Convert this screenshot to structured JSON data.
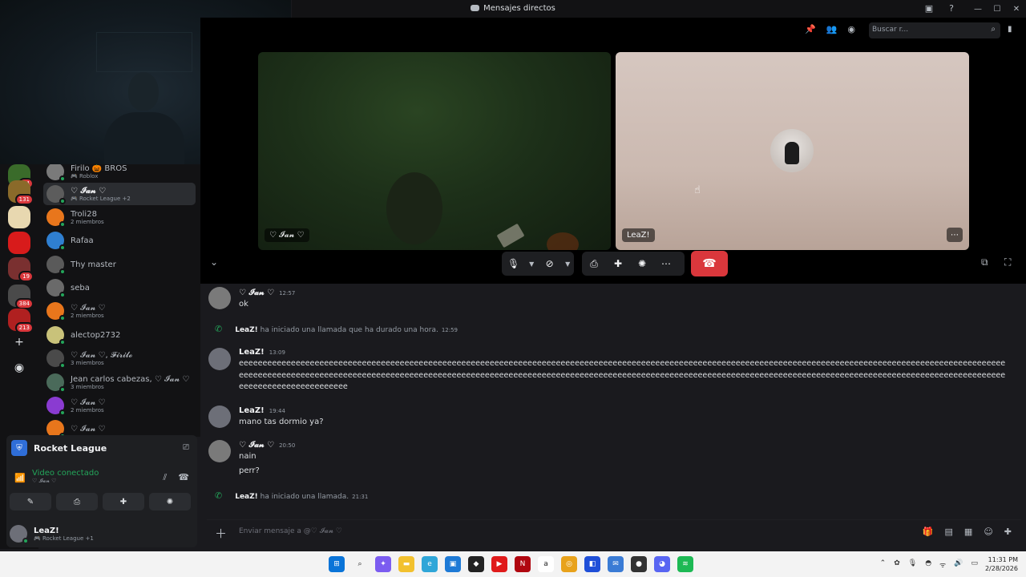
{
  "window": {
    "title": "Mensajes directos"
  },
  "search": {
    "placeholder": "Buscar r..."
  },
  "servers": [
    {
      "color": "#3a6b2a",
      "badge": "14"
    },
    {
      "color": "#8a6a2a",
      "badge": "131"
    },
    {
      "color": "#e8d8b0",
      "badge": ""
    },
    {
      "color": "#d81b1b",
      "badge": ""
    },
    {
      "color": "#7a3030",
      "badge": "19"
    },
    {
      "color": "#4a4a4a",
      "badge": "384"
    },
    {
      "color": "#b02020",
      "badge": "213"
    }
  ],
  "dms": [
    {
      "name": "Firilo 🎃 BROS",
      "sub": "🎮 Roblox",
      "color": "#7a7a7a",
      "active": false
    },
    {
      "name": "♡ 𝓘𝓪𝓷 ♡",
      "sub": "🎮 Rocket League +2",
      "color": "#5c5c5c",
      "active": true
    },
    {
      "name": "Troli28",
      "sub": "2 miembros",
      "color": "#e8761c",
      "active": false
    },
    {
      "name": "Rafaa",
      "sub": "",
      "color": "#2f7fd1",
      "active": false
    },
    {
      "name": "Thy master",
      "sub": "",
      "color": "#5a5a5a",
      "active": false
    },
    {
      "name": "seba",
      "sub": "",
      "color": "#6a6a6a",
      "active": false
    },
    {
      "name": "♡ 𝓘𝓪𝓷 ♡",
      "sub": "2 miembros",
      "color": "#e8761c",
      "active": false
    },
    {
      "name": "alectop2732",
      "sub": "",
      "color": "#c9c27a",
      "active": false
    },
    {
      "name": "♡ 𝓘𝓪𝓷 ♡, 𝓕𝓲𝓻𝓲𝓵𝓸",
      "sub": "3 miembros",
      "color": "#4a4a4a",
      "active": false
    },
    {
      "name": "Jean carlos cabezas, ♡ 𝓘𝓪𝓷 ♡",
      "sub": "3 miembros",
      "color": "#4a6a5a",
      "active": false
    },
    {
      "name": "♡ 𝓘𝓪𝓷 ♡",
      "sub": "2 miembros",
      "color": "#8a3bd1",
      "active": false
    },
    {
      "name": "♡ 𝓘𝓪𝓷 ♡",
      "sub": "",
      "color": "#e8761c",
      "active": false
    }
  ],
  "voice": {
    "game": "Rocket League",
    "status": "Video conectado",
    "channel": "♡ 𝓘𝓪𝓷 ♡"
  },
  "user": {
    "name": "LeaZ!",
    "status": "🎮 Rocket League +1"
  },
  "call": {
    "tile1_name": "♡ 𝓘𝓪𝓷 ♡",
    "tile2_name": "LeaZ!"
  },
  "messages": {
    "m1": {
      "author": "♡ 𝓘𝓪𝓷 ♡",
      "time": "12:57",
      "text": "ok"
    },
    "s1": {
      "who": "LeaZ!",
      "text": "ha iniciado una llamada que ha durado una hora.",
      "time": "12:59"
    },
    "m2": {
      "author": "LeaZ!",
      "time": "13:09",
      "text": "eeeeeeeeeeeeeeeeeeeeeeeeeeeeeeeeeeeeeeeeeeeeeeeeeeeeeeeeeeeeeeeeeeeeeeeeeeeeeeeeeeeeeeeeeeeeeeeeeeeeeeeeeeeeeeeeeeeeeeeeeeeeeeeeeeeeeeeeeeeeeeeeeeeeeeeeeeeeeeeeeeeeeeeeeeeeeeeeeeeeeeeeeeeeeeeeeeeeeeeeeeeeeeeeeeeeeeeeeeeeeeeeeeeeeeeeeeeeeeeeeeeeeeeeeeeeeeeeeeeeeeeeeeeeeeeeeeeeeeeeeeeeeeeeeeeeeeeeeeeeeeeeeeeeeeeeeeeeeeeeeeeeeeeeeeeeeeeeeeeeeeeeeee"
    },
    "m3": {
      "author": "LeaZ!",
      "time": "19:44",
      "text": "mano tas dormio ya?"
    },
    "m4": {
      "author": "♡ 𝓘𝓪𝓷 ♡",
      "time": "20:50",
      "text1": "nain",
      "text2": "perr?"
    },
    "s2": {
      "who": "LeaZ!",
      "text": "ha iniciado una llamada.",
      "time": "21:31"
    }
  },
  "composer": {
    "placeholder": "Enviar mensaje a @♡ 𝓘𝓪𝓷 ♡"
  },
  "clock": {
    "time": "11:31 PM",
    "date": "2/28/2026"
  },
  "colors": {
    "online": "#23a55a",
    "danger": "#da373c",
    "bg": "#1a1a1e"
  }
}
